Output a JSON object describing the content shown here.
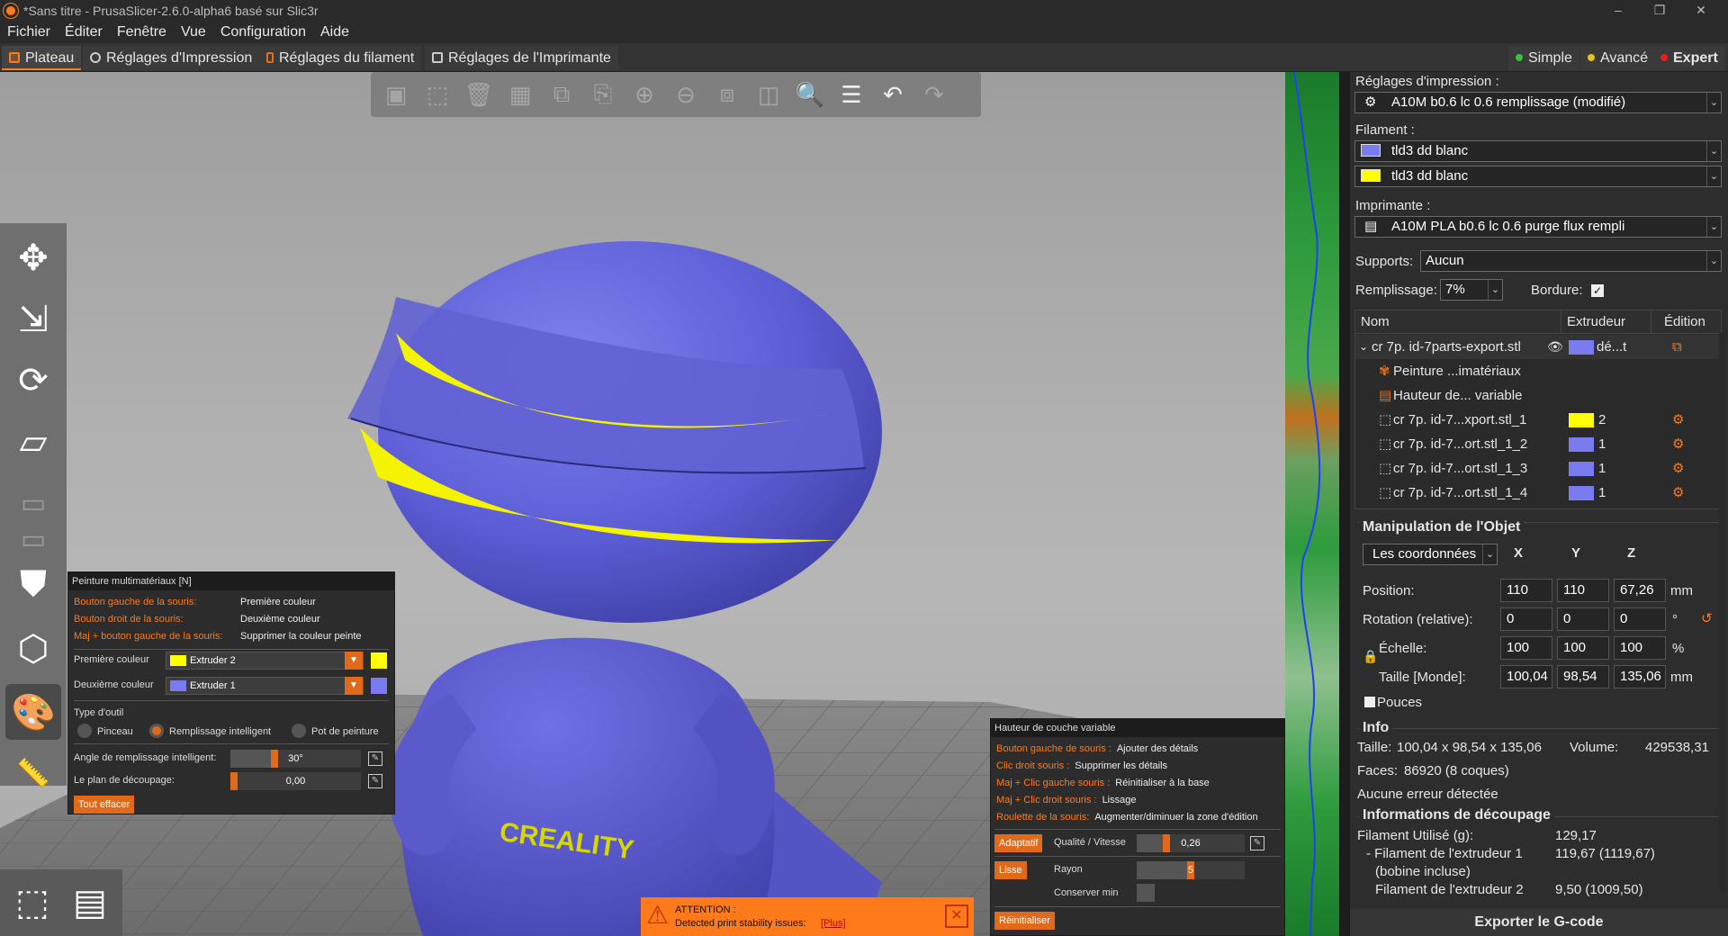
{
  "app": {
    "title": "*Sans titre - PrusaSlicer-2.6.0-alpha6 basé sur Slic3r"
  },
  "window_controls": {
    "minimize": "–",
    "restore": "❐",
    "close": "✕"
  },
  "menu": [
    "Fichier",
    "Éditer",
    "Fenêtre",
    "Vue",
    "Configuration",
    "Aide"
  ],
  "tabs": [
    "Plateau",
    "Réglages d'Impression",
    "Réglages du filament",
    "Réglages de l'Imprimante"
  ],
  "modes": [
    {
      "label": "Simple",
      "color": "#3fbf3f"
    },
    {
      "label": "Avancé",
      "color": "#e8c21a"
    },
    {
      "label": "Expert",
      "color": "#e02020"
    }
  ],
  "viewport": {
    "logo_text": "CREALITY"
  },
  "paint_panel": {
    "title": "Peinture multimatériaux [N]",
    "hints": [
      {
        "key": "Bouton gauche de la souris:",
        "value": "Première couleur"
      },
      {
        "key": "Bouton droit de la souris:",
        "value": "Deuxième couleur"
      },
      {
        "key": "Maj + bouton gauche de la souris:",
        "value": "Supprimer la couleur peinte"
      }
    ],
    "first_color_label": "Première couleur",
    "first_color_value": "Extruder 2",
    "second_color_label": "Deuxième couleur",
    "second_color_value": "Extruder 1",
    "tool_type_label": "Type d'outil",
    "tools": [
      "Pinceau",
      "Remplissage intelligent",
      "Pot de peinture"
    ],
    "selected_tool": 1,
    "angle_label": "Angle de remplissage intelligent:",
    "angle_value": "30°",
    "angle_fraction": 0.33,
    "cut_label": "Le plan de découpage:",
    "cut_value": "0,00",
    "cut_fraction": 0.0,
    "clear_button": "Tout effacer",
    "colors": {
      "extruder1": "#7b7bf0",
      "extruder2": "#ffff00"
    }
  },
  "varlayer_panel": {
    "title": "Hauteur de couche variable",
    "hints": [
      {
        "key": "Bouton gauche de souris :",
        "value": "Ajouter des détails"
      },
      {
        "key": "Clic droit souris :",
        "value": "Supprimer les détails"
      },
      {
        "key": "Maj + Clic gauche souris :",
        "value": "Réinitialiser à la base"
      },
      {
        "key": "Maj + Clic droit souris :",
        "value": "Lissage"
      },
      {
        "key": "Roulette de la souris:",
        "value": "Augmenter/diminuer la zone d'édition"
      }
    ],
    "adaptive_button": "Adaptatif",
    "quality_label": "Qualité / Vitesse",
    "quality_value": "0,26",
    "quality_fraction": 0.26,
    "smooth_button": "Lisse",
    "radius_label": "Rayon",
    "radius_value": "5",
    "radius_fraction": 0.5,
    "keep_min_label": "Conserver min",
    "reset_button": "Réinitialiser"
  },
  "warning": {
    "title": "ATTENTION :",
    "text": "Detected print stability issues:",
    "link": "[Plus]"
  },
  "right_panel": {
    "print_settings_label": "Réglages d'impression :",
    "print_settings_value": "A10M b0.6 lc 0.6 remplissage (modifié)",
    "filament_label": "Filament :",
    "filaments": [
      {
        "name": "tld3 dd blanc",
        "color": "#7b7bf0"
      },
      {
        "name": "tld3 dd blanc",
        "color": "#ffff00"
      }
    ],
    "printer_label": "Imprimante :",
    "printer_value": "A10M PLA b0.6 lc 0.6 purge flux rempli",
    "supports_label": "Supports:",
    "supports_value": "Aucun",
    "infill_label": "Remplissage:",
    "infill_value": "7%",
    "brim_label": "Bordure:",
    "brim_checked": true,
    "object_list": {
      "headers": [
        "Nom",
        "Extrudeur",
        "Édition"
      ],
      "object": {
        "name": "cr 7p. id-7parts-export.stl",
        "extruder": "dé...t"
      },
      "children": [
        {
          "name": "Peinture ...imatériaux"
        },
        {
          "name": "Hauteur de... variable"
        }
      ],
      "parts": [
        {
          "name": "cr 7p. id-7...xport.stl_1",
          "extruder": "2",
          "color": "#ffff00"
        },
        {
          "name": "cr 7p. id-7...ort.stl_1_2",
          "extruder": "1",
          "color": "#7b7bf0"
        },
        {
          "name": "cr 7p. id-7...ort.stl_1_3",
          "extruder": "1",
          "color": "#7b7bf0"
        },
        {
          "name": "cr 7p. id-7...ort.stl_1_4",
          "extruder": "1",
          "color": "#7b7bf0"
        }
      ]
    },
    "manip": {
      "title": "Manipulation de l'Objet",
      "coords_value": "Les coordonnées",
      "axes": [
        "X",
        "Y",
        "Z"
      ],
      "position_label": "Position:",
      "position": [
        "110",
        "110",
        "67,26"
      ],
      "position_unit": "mm",
      "rotation_label": "Rotation (relative):",
      "rotation": [
        "0",
        "0",
        "0"
      ],
      "rotation_unit": "°",
      "scale_label": "Échelle:",
      "scale": [
        "100",
        "100",
        "100"
      ],
      "scale_unit": "%",
      "size_label": "Taille [Monde]:",
      "size": [
        "100,04",
        "98,54",
        "135,06"
      ],
      "size_unit": "mm",
      "inches_label": "Pouces"
    },
    "info": {
      "title": "Info",
      "size_label": "Taille:",
      "size_value": "100,04 x 98,54 x 135,06",
      "volume_label": "Volume:",
      "volume_value": "429538,31",
      "faces_label": "Faces:",
      "faces_value": "86920 (8 coques)",
      "errors_text": "Aucune erreur détectée"
    },
    "slicing": {
      "title": "Informations de découpage",
      "filament_used_label": "Filament Utilisé (g):",
      "filament_used_value": "129,17",
      "ext1_label": "- Filament de l'extrudeur 1",
      "ext1_value": "119,67 (1119,67)",
      "ext1_note": "(bobine incluse)",
      "ext2_label": "Filament de l'extrudeur 2",
      "ext2_value": "9,50 (1009,50)"
    },
    "export_button": "Exporter le G-code"
  }
}
